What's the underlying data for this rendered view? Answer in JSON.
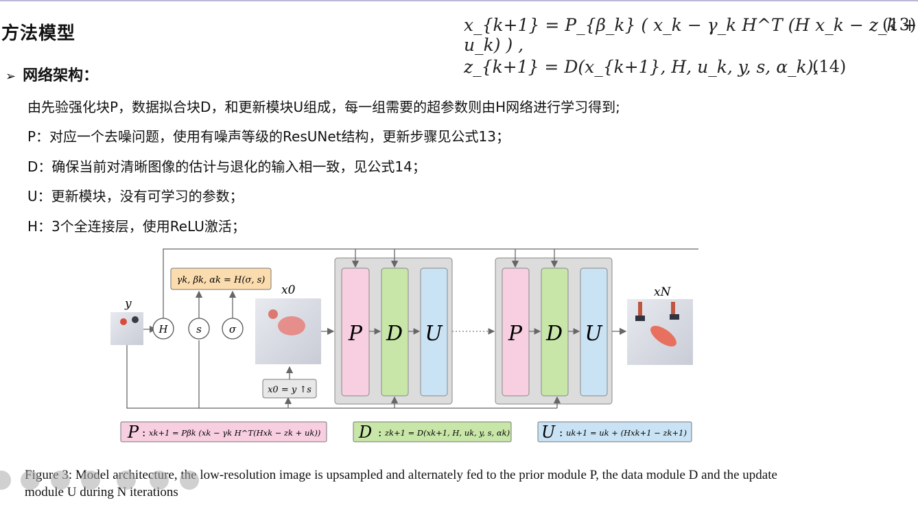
{
  "slide": {
    "title": "方法模型",
    "bullet_heading": "网络架构：",
    "lines": [
      "由先验强化块P，数据拟合块D，和更新模块U组成，每一组需要的超参数则由H网络进行学习得到;",
      "P：对应一个去噪问题，使用有噪声等级的ResUNet结构，更新步骤见公式13；",
      "D：确保当前对清晰图像的估计与退化的输入相一致，见公式14；",
      "U：更新模块，没有可学习的参数；",
      "H：3个全连接层，使用ReLU激活；"
    ],
    "equations": [
      {
        "text": "x_{k+1} = P_{β_k} ( x_k − γ_k H^T (H x_k − z_k + u_k) ) ,",
        "number": "(13)"
      },
      {
        "text": "z_{k+1} = D(x_{k+1}, H, u_k, y, s, α_k),",
        "number": "(14)"
      }
    ]
  },
  "figure": {
    "input_label": "y",
    "x0_label": "x0",
    "output_label": "xN",
    "h_box": "γk, βk, αk = H(σ, s)",
    "circles": [
      "H",
      "s",
      "σ"
    ],
    "upsample_box": "x0 = y ↑s",
    "module_letters": [
      "P",
      "D",
      "U"
    ],
    "legend": [
      {
        "symbol": "P",
        "formula": "xk+1 = Pβk (xk − γk H^T(Hxk − zk + uk))",
        "color": "#f7cfe0"
      },
      {
        "symbol": "D",
        "formula": "zk+1 = D(xk+1, H, uk, y, s, αk)",
        "color": "#c8e6a8"
      },
      {
        "symbol": "U",
        "formula": "uk+1 = uk + (Hxk+1 − zk+1)",
        "color": "#c9e3f5"
      }
    ],
    "caption": "Figure 3: Model architecture, the low-resolution image is upsampled and alternately fed to the prior module P, the data module D and the update module U during N iterations"
  },
  "colors": {
    "pink": "#f7cfe0",
    "green": "#c8e6a8",
    "blue": "#c9e3f5",
    "orange": "#fbdcae",
    "gray": "#dcdcdc"
  },
  "toolbar_icons": [
    "menu-icon",
    "pen-icon",
    "laser-icon",
    "video-icon",
    "screen-icon",
    "more-icon",
    "back-icon"
  ]
}
